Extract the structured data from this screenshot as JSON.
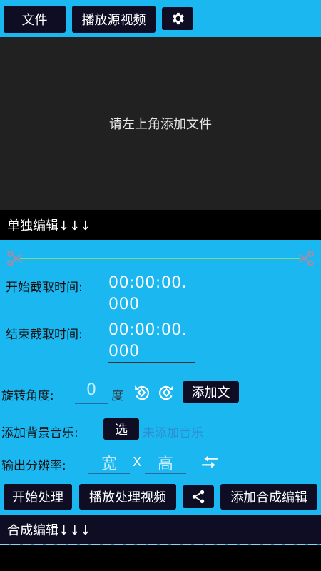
{
  "toolbar": {
    "file_label": "文件",
    "play_source_label": "播放源视频",
    "settings_icon": "gear-icon"
  },
  "video": {
    "placeholder": "请左上角添加文件"
  },
  "single_edit": {
    "title": "单独编辑↓↓↓"
  },
  "trim": {
    "start_label": "开始截取时间:",
    "start_value_line1": "00:00:00.",
    "start_value_line2": "000",
    "end_label": "结束截取时间:",
    "end_value_line1": "00:00:00.",
    "end_value_line2": "000"
  },
  "rotation": {
    "label": "旋转角度:",
    "value": "0",
    "unit": "度",
    "add_text_label": "添加文"
  },
  "music": {
    "label": "添加背景音乐:",
    "select_label": "选",
    "status": "未添加音乐"
  },
  "resolution": {
    "label": "输出分辨率:",
    "width_placeholder": "宽",
    "separator": "X",
    "height_placeholder": "高"
  },
  "actions": {
    "start_label": "开始处理",
    "play_processed_label": "播放处理视频",
    "add_merge_label": "添加合成编辑"
  },
  "merge_edit": {
    "title": "合成编辑↓↓↓"
  },
  "colors": {
    "accent": "#1ab7f0",
    "button_bg": "#0e0d24",
    "video_bg": "#212121",
    "scissor": "#9b8fae",
    "trim_line": "#7fd98a"
  }
}
